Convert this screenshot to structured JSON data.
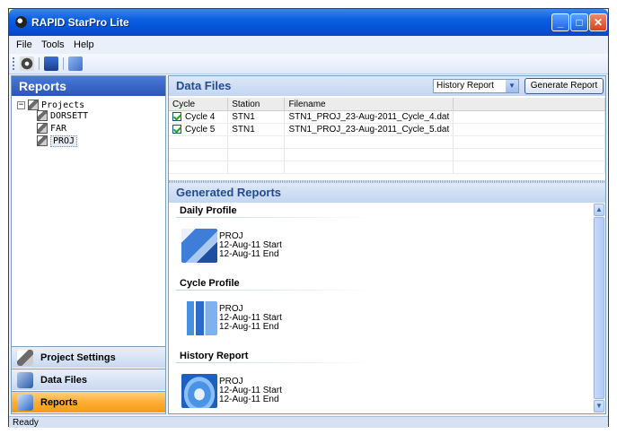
{
  "window": {
    "title": "RAPID StarPro Lite"
  },
  "menu": [
    "File",
    "Tools",
    "Help"
  ],
  "sidebar": {
    "title": "Reports",
    "tree": {
      "root": "Projects",
      "children": [
        "DORSETT",
        "FAR",
        "PROJ"
      ],
      "selected": "PROJ"
    },
    "nav": [
      {
        "label": "Project Settings",
        "active": false
      },
      {
        "label": "Data Files",
        "active": false
      },
      {
        "label": "Reports",
        "active": true
      }
    ]
  },
  "data_files": {
    "title": "Data Files",
    "report_type": "History Report",
    "generate_label": "Generate Report",
    "columns": [
      "Cycle",
      "Station",
      "Filename"
    ],
    "rows": [
      {
        "checked": true,
        "cycle": "Cycle 4",
        "station": "STN1",
        "filename": "STN1_PROJ_23-Aug-2011_Cycle_4.dat"
      },
      {
        "checked": true,
        "cycle": "Cycle 5",
        "station": "STN1",
        "filename": "STN1_PROJ_23-Aug-2011_Cycle_5.dat"
      }
    ]
  },
  "generated": {
    "title": "Generated Reports",
    "reports": [
      {
        "name": "Daily Profile",
        "project": "PROJ",
        "start": "12-Aug-11 Start",
        "end": "12-Aug-11 End"
      },
      {
        "name": "Cycle Profile",
        "project": "PROJ",
        "start": "12-Aug-11 Start",
        "end": "12-Aug-11 End"
      },
      {
        "name": "History Report",
        "project": "PROJ",
        "start": "12-Aug-11 Start",
        "end": "12-Aug-11 End"
      }
    ]
  },
  "status": "Ready",
  "colors": {
    "title_bar": "#0a5fe0",
    "panel_header": "#3a66c4",
    "active_nav": "#ffae35"
  }
}
